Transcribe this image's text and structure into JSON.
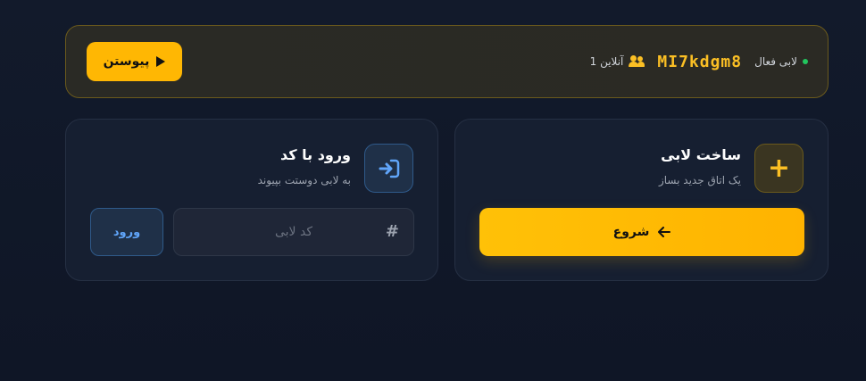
{
  "active_lobby": {
    "status_label": "لابی فعال",
    "code": "MI7kdgm8",
    "online_count_label": "1 آنلاین",
    "join_button_label": "پیوستن"
  },
  "create_card": {
    "title": "ساخت لابی",
    "subtitle": "یک اتاق جدید بساز",
    "icon": "plus-icon",
    "start_button_label": "شروع"
  },
  "join_card": {
    "title": "ورود با کد",
    "subtitle": "به لابی دوستت بپیوند",
    "icon": "sign-in-icon",
    "code_input_value": "",
    "code_input_placeholder": "کد لابی",
    "enter_button_label": "ورود"
  },
  "colors": {
    "accent": "#ffb703",
    "background": "#111827",
    "card": "#161f31",
    "blue": "#60a5fa",
    "online_dot": "#22c55e"
  }
}
